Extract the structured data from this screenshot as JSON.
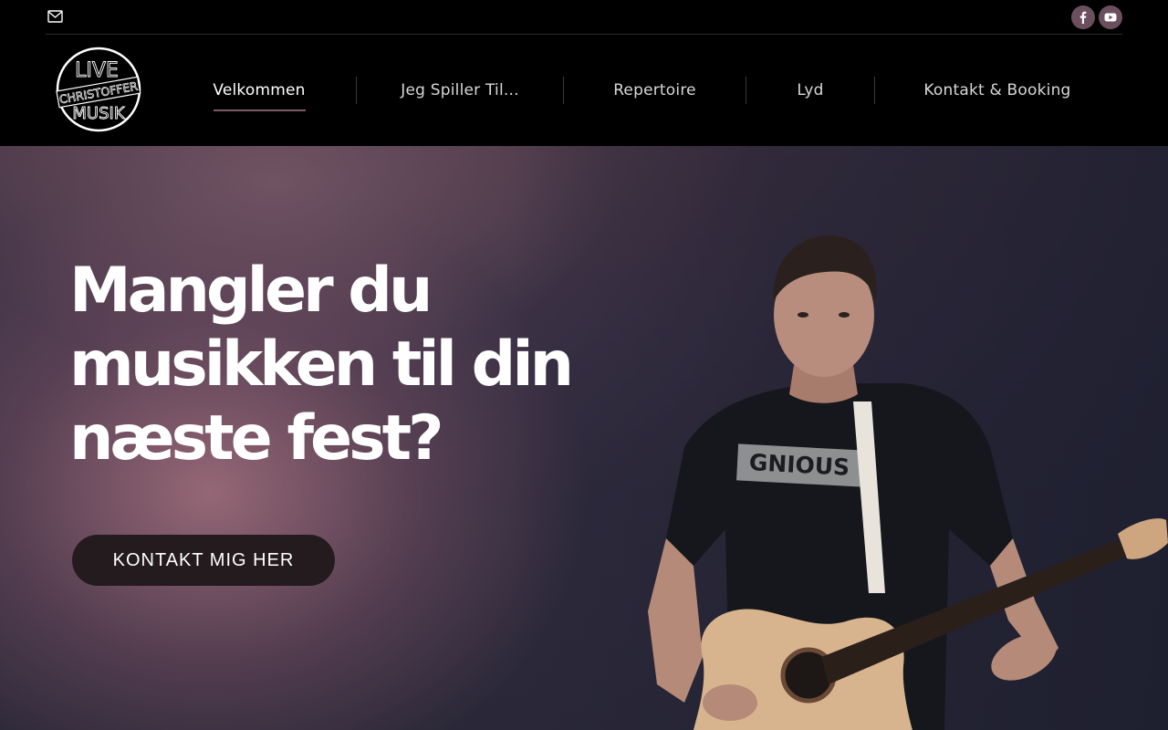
{
  "topbar": {
    "mail_icon": "mail-icon",
    "social": [
      "facebook-icon",
      "youtube-icon"
    ],
    "social_color": "#6b4f5e"
  },
  "logo": {
    "line1": "LIVE",
    "line2": "CHRISTOFFER",
    "line3": "MUSIK"
  },
  "nav": {
    "items": [
      {
        "label": "Velkommen",
        "active": true
      },
      {
        "label": "Jeg Spiller Til..."
      },
      {
        "label": "Repertoire"
      },
      {
        "label": "Lyd"
      },
      {
        "label": "Kontakt & Booking"
      }
    ],
    "accent": "#7b5868"
  },
  "hero": {
    "headline_line1": "Mangler du",
    "headline_line2": "musikken til din",
    "headline_line3": "næste fest?",
    "cta_label": "KONTAKT MIG HER",
    "shirt_text": "GNIOUS"
  }
}
